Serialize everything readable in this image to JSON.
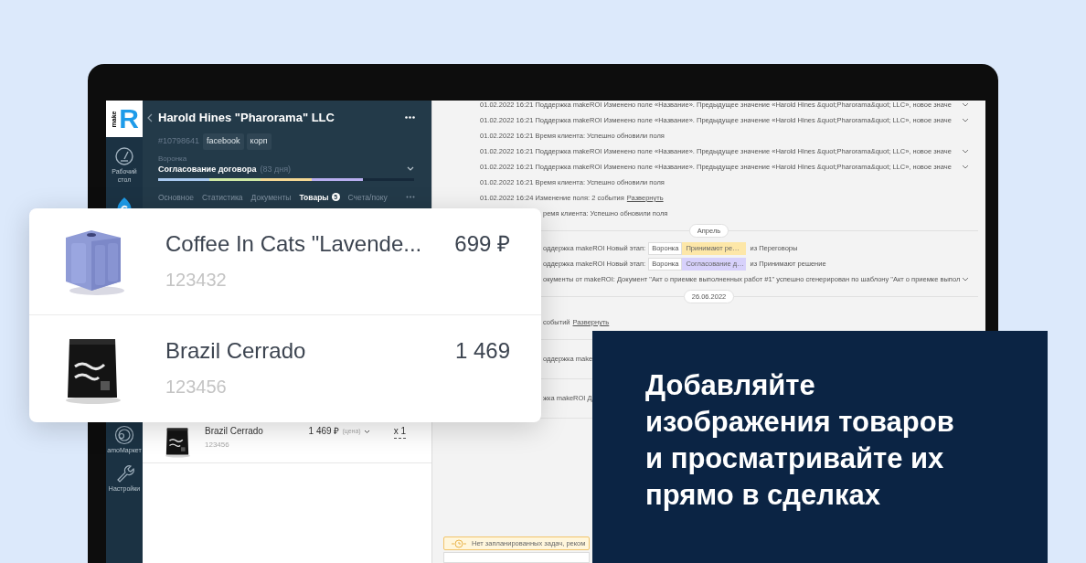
{
  "sidebar": {
    "logo": {
      "word": "make",
      "letter": "R"
    },
    "items": [
      {
        "kind": "gauge",
        "label": "Рабочий стол"
      },
      {
        "kind": "drop"
      },
      {
        "kind": "market",
        "label": "amoМаркет"
      },
      {
        "kind": "wrench",
        "label": "Настройки"
      }
    ]
  },
  "deal": {
    "title": "Harold Hines \"Pharorama\" LLC",
    "number": "#10798641",
    "tags": [
      "facebook",
      "корп"
    ],
    "pipeline_label": "Воронка",
    "stage": "Согласование договора",
    "days": "(83 дня)",
    "level": 0.8,
    "tabs": [
      {
        "label": "Основное",
        "selected": false
      },
      {
        "label": "Статистика",
        "selected": false
      },
      {
        "label": "Документы",
        "selected": false
      },
      {
        "label": "Товары",
        "selected": true,
        "badge": "5"
      },
      {
        "label": "Счета/поку",
        "selected": false
      }
    ]
  },
  "deal_product": {
    "name": "Brazil Cerrado",
    "sku": "123456",
    "price": "1 469 ₽",
    "price_label": "(цена)",
    "qty": "x 1"
  },
  "feed": [
    {
      "kind": "event",
      "cut": false,
      "expandable": true,
      "text": "01.02.2022 16:21 Поддержка makeROI Изменено поле «Название». Предыдущее значение «Harold Hines &quot;Pharorama&quot; LLC», новое значе"
    },
    {
      "kind": "event",
      "cut": false,
      "expandable": true,
      "text": "01.02.2022 16:21 Поддержка makeROI Изменено поле «Название». Предыдущее значение «Harold Hines &quot;Pharorama&quot; LLC», новое значе"
    },
    {
      "kind": "event",
      "cut": false,
      "expandable": false,
      "text": "01.02.2022 16:21 Время клиента: Успешно обновили поля"
    },
    {
      "kind": "event",
      "cut": false,
      "expandable": true,
      "text": "01.02.2022 16:21 Поддержка makeROI Изменено поле «Название». Предыдущее значение «Harold Hines &quot;Pharorama&quot; LLC», новое значе"
    },
    {
      "kind": "event",
      "cut": false,
      "expandable": true,
      "text": "01.02.2022 16:21 Поддержка makeROI Изменено поле «Название». Предыдущее значение «Harold Hines &quot;Pharorama&quot; LLC», новое значе"
    },
    {
      "kind": "event",
      "cut": false,
      "expandable": false,
      "text": "01.02.2022 16:21 Время клиента: Успешно обновили поля"
    },
    {
      "kind": "event",
      "cut": false,
      "expandable": false,
      "text": "01.02.2022 16:24 Изменение поля: 2 события",
      "link": "Развернуть"
    },
    {
      "kind": "event",
      "cut": true,
      "expandable": false,
      "text": "ремя клиента: Успешно обновили поля"
    },
    {
      "kind": "divider",
      "text": "Апрель"
    },
    {
      "kind": "stage",
      "cut": true,
      "text": "оддержка makeROI Новый этап:",
      "pipeline": "Воронка",
      "stage": "Принимают ре…",
      "color": "#fde7a8",
      "tail": "из Переговоры"
    },
    {
      "kind": "stage",
      "cut": true,
      "text": "оддержка makeROI Новый этап:",
      "pipeline": "Воронка",
      "stage": "Согласование д…",
      "color": "#d7d1fb",
      "tail": "из Принимают решение"
    },
    {
      "kind": "event",
      "cut": true,
      "expandable": true,
      "text": "окументы от makeROI: Документ \"Акт о приемке выполненных работ #1\" успешно сгенерирован по шаблону \"Акт о приемке выпол"
    },
    {
      "kind": "divider",
      "text": "26.06.2022"
    },
    {
      "kind": "event",
      "cut": true,
      "expandable": false,
      "text": "событий",
      "link": "Развернуть",
      "tall": true
    },
    {
      "kind": "block",
      "cut": true,
      "text": "оддержка make"
    },
    {
      "kind": "block",
      "cut": true,
      "text": "жка makeROI Д"
    }
  ],
  "notice": "Нет запланированных задач, реком",
  "products": [
    {
      "name": "Coffee In Cats \"Lavende...",
      "sku": "123432",
      "price": "699 ₽"
    },
    {
      "name": "Brazil Cerrado",
      "sku": "123456",
      "price": "1 469"
    }
  ],
  "headline": "Добавляйте\nизображения товаров\nи просматривайте их\nпрямо в сделках"
}
